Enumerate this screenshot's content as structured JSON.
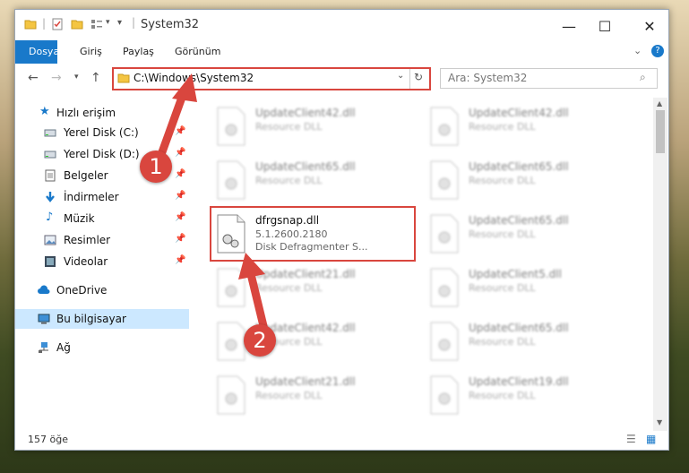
{
  "window": {
    "title": "System32"
  },
  "ribbon": {
    "tabs": [
      "Dosya",
      "Giriş",
      "Paylaş",
      "Görünüm"
    ]
  },
  "address": {
    "path": "C:\\Windows\\System32"
  },
  "search": {
    "placeholder": "Ara: System32"
  },
  "sidebar": {
    "items": [
      {
        "label": "Hızlı erişim",
        "icon": "star-icon",
        "pinned": false
      },
      {
        "label": "Yerel Disk (C:)",
        "icon": "drive-icon",
        "pinned": true
      },
      {
        "label": "Yerel Disk (D:)",
        "icon": "drive-icon",
        "pinned": true
      },
      {
        "label": "Belgeler",
        "icon": "document-icon",
        "pinned": true
      },
      {
        "label": "İndirmeler",
        "icon": "download-icon",
        "pinned": true
      },
      {
        "label": "Müzik",
        "icon": "music-icon",
        "pinned": true
      },
      {
        "label": "Resimler",
        "icon": "picture-icon",
        "pinned": true
      },
      {
        "label": "Videolar",
        "icon": "video-icon",
        "pinned": true
      },
      {
        "label": "OneDrive",
        "icon": "cloud-icon",
        "pinned": false
      },
      {
        "label": "Bu bilgisayar",
        "icon": "computer-icon",
        "pinned": false,
        "selected": true
      },
      {
        "label": "Ağ",
        "icon": "network-icon",
        "pinned": false
      }
    ]
  },
  "files": {
    "left": [
      {
        "name": "UpdateClient42.dll",
        "desc": "Resource DLL"
      },
      {
        "name": "UpdateClient65.dll",
        "desc": "Resource DLL"
      },
      {
        "name": "dfrgsnap.dll",
        "version": "5.1.2600.2180",
        "desc": "Disk Defragmenter S...",
        "highlighted": true
      },
      {
        "name": "UpdateClient21.dll",
        "desc": "Resource DLL"
      },
      {
        "name": "UpdateClient42.dll",
        "desc": "Resource DLL"
      },
      {
        "name": "UpdateClient21.dll",
        "desc": "Resource DLL"
      }
    ],
    "right": [
      {
        "name": "UpdateClient42.dll",
        "desc": "Resource DLL"
      },
      {
        "name": "UpdateClient65.dll",
        "desc": "Resource DLL"
      },
      {
        "name": "UpdateClient65.dll",
        "desc": "Resource DLL"
      },
      {
        "name": "UpdateClient5.dll",
        "desc": "Resource DLL"
      },
      {
        "name": "UpdateClient65.dll",
        "desc": "Resource DLL"
      },
      {
        "name": "UpdateClient19.dll",
        "desc": "Resource DLL"
      }
    ]
  },
  "status": {
    "count": "157 öğe"
  },
  "annotations": {
    "step1": "1",
    "step2": "2"
  },
  "colors": {
    "accent": "#1979ca",
    "highlight": "#d9463e",
    "selected": "#cce8ff"
  }
}
